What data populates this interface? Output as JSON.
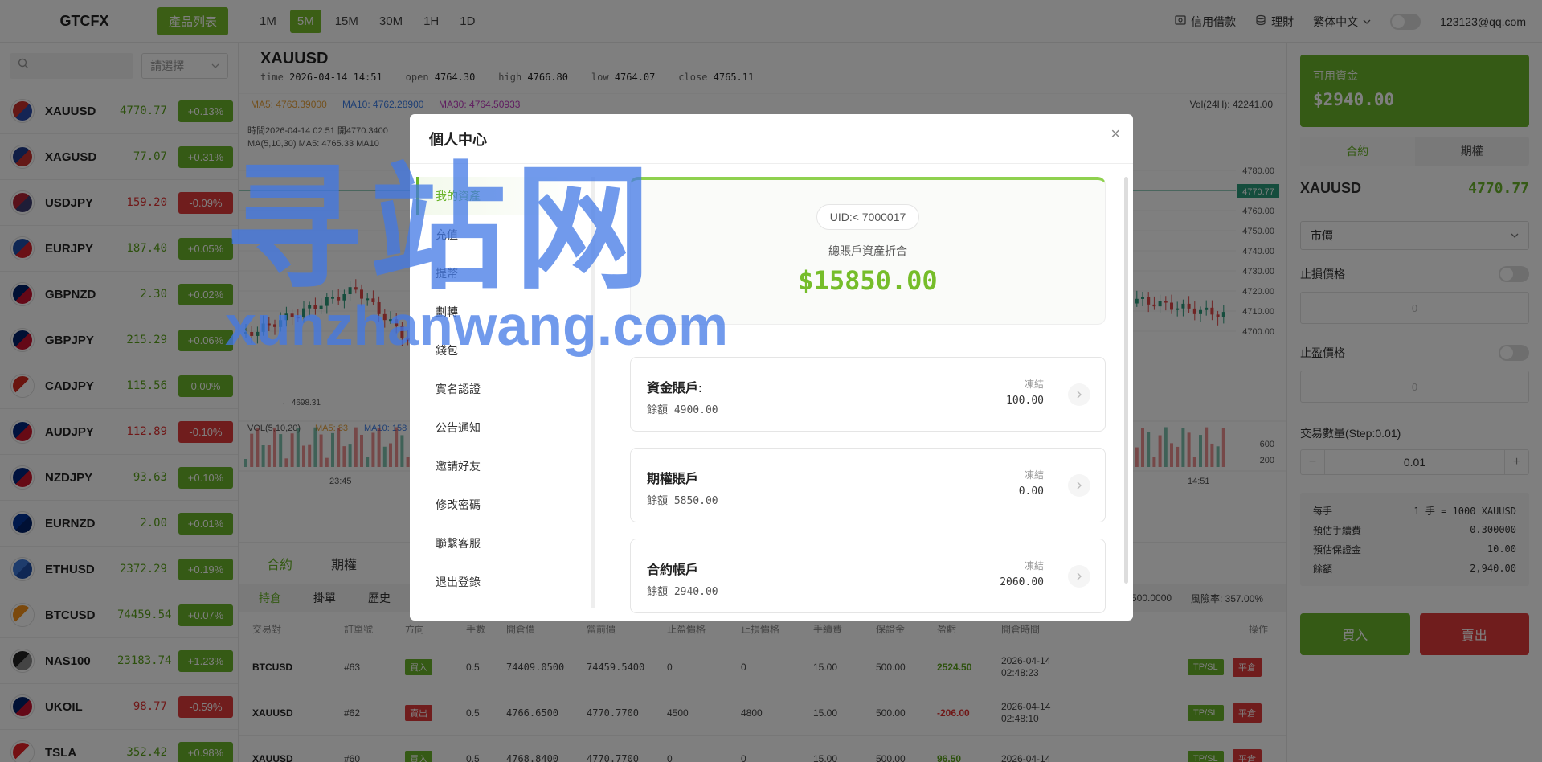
{
  "topbar": {
    "brand": "GTCFX",
    "product_list": "產品列表",
    "intervals": [
      "1M",
      "5M",
      "15M",
      "30M",
      "1H",
      "1D"
    ],
    "active_interval": "5M",
    "credit_loan": "信用借款",
    "finance": "理財",
    "language": "繁体中文",
    "user_email": "123123@qq.com"
  },
  "left": {
    "select_placeholder": "請選擇",
    "symbols": [
      {
        "name": "XAUUSD",
        "price": "4770.77",
        "change": "+0.13%",
        "dir": "up"
      },
      {
        "name": "XAGUSD",
        "price": "77.07",
        "change": "+0.31%",
        "dir": "up"
      },
      {
        "name": "USDJPY",
        "price": "159.20",
        "change": "-0.09%",
        "dir": "dn"
      },
      {
        "name": "EURJPY",
        "price": "187.40",
        "change": "+0.05%",
        "dir": "up"
      },
      {
        "name": "GBPNZD",
        "price": "2.30",
        "change": "+0.02%",
        "dir": "up"
      },
      {
        "name": "GBPJPY",
        "price": "215.29",
        "change": "+0.06%",
        "dir": "up"
      },
      {
        "name": "CADJPY",
        "price": "115.56",
        "change": "0.00%",
        "dir": "up"
      },
      {
        "name": "AUDJPY",
        "price": "112.89",
        "change": "-0.10%",
        "dir": "dn"
      },
      {
        "name": "NZDJPY",
        "price": "93.63",
        "change": "+0.10%",
        "dir": "up"
      },
      {
        "name": "EURNZD",
        "price": "2.00",
        "change": "+0.01%",
        "dir": "up"
      },
      {
        "name": "ETHUSD",
        "price": "2372.29",
        "change": "+0.19%",
        "dir": "up"
      },
      {
        "name": "BTCUSD",
        "price": "74459.54",
        "change": "+0.07%",
        "dir": "up"
      },
      {
        "name": "NAS100",
        "price": "23183.74",
        "change": "+1.23%",
        "dir": "up"
      },
      {
        "name": "UKOIL",
        "price": "98.77",
        "change": "-0.59%",
        "dir": "dn"
      },
      {
        "name": "TSLA",
        "price": "352.42",
        "change": "+0.98%",
        "dir": "up"
      }
    ]
  },
  "chart": {
    "symbol": "XAUUSD",
    "time_label": "time",
    "time": "2026-04-14 14:51",
    "open_label": "open",
    "open": "4764.30",
    "high_label": "high",
    "high": "4766.80",
    "low_label": "low",
    "low": "4764.07",
    "close_label": "close",
    "close": "4765.11",
    "ma5": "MA5: 4763.39000",
    "ma10": "MA10: 4762.28900",
    "ma30": "MA30: 4764.50933",
    "vol24h": "Vol(24H): 42241.00",
    "tooltip_line1": "時間2026-04-14 02:51  開4770.3400",
    "tooltip_line2": "MA(5,10,30)  MA5: 4765.33  MA10",
    "low_marker": "← 4698.31",
    "vol_label": "VOL(5,10,20)",
    "vol_ma5": "MA5: 83",
    "vol_ma10": "MA10: 158",
    "y_ticks": [
      "4780.00",
      "4770.00",
      "4760.00",
      "4750.00",
      "4740.00",
      "4730.00",
      "4720.00",
      "4710.00",
      "4700.00"
    ],
    "current_price_tag": "4770.77",
    "vol_ticks": [
      "600",
      "200"
    ],
    "x_ticks": [
      "23:45",
      "14:51"
    ],
    "colors": {
      "ma5": "#e8a23a",
      "ma10": "#3a7de8",
      "ma30": "#c03ac0",
      "up": "#2a9a7a",
      "down": "#e04848"
    }
  },
  "orders": {
    "tabs": [
      "合約",
      "期權"
    ],
    "subtabs": [
      "持倉",
      "掛單",
      "歷史"
    ],
    "summary_a": "500.0000",
    "summary_b": "風險率: 357.00%",
    "headers": [
      "交易對",
      "訂單號",
      "方向",
      "手數",
      "開倉價",
      "當前價",
      "止盈價格",
      "止損價格",
      "手續費",
      "保證金",
      "盈虧",
      "開倉時間",
      "操作"
    ],
    "rows": [
      {
        "pair": "BTCUSD",
        "id": "#63",
        "side": "買入",
        "side_dir": "up",
        "lots": "0.5",
        "open": "74409.0500",
        "cur": "74459.5400",
        "tp": "0",
        "sl": "0",
        "fee": "15.00",
        "margin": "500.00",
        "pnl": "2524.50",
        "pnl_dir": "up",
        "date": "2026-04-14",
        "time": "02:48:23"
      },
      {
        "pair": "XAUUSD",
        "id": "#62",
        "side": "賣出",
        "side_dir": "dn",
        "lots": "0.5",
        "open": "4766.6500",
        "cur": "4770.7700",
        "tp": "4500",
        "sl": "4800",
        "fee": "15.00",
        "margin": "500.00",
        "pnl": "-206.00",
        "pnl_dir": "dn",
        "date": "2026-04-14",
        "time": "02:48:10"
      },
      {
        "pair": "XAUUSD",
        "id": "#60",
        "side": "買入",
        "side_dir": "up",
        "lots": "0.5",
        "open": "4768.8400",
        "cur": "4770.7700",
        "tp": "0",
        "sl": "0",
        "fee": "15.00",
        "margin": "500.00",
        "pnl": "96.50",
        "pnl_dir": "up",
        "date": "2026-04-14",
        "time": ""
      }
    ],
    "tpsl_label": "TP/SL",
    "close_label": "平倉"
  },
  "right": {
    "available_label": "可用資金",
    "available_value": "$2940.00",
    "tabs": [
      "合約",
      "期權"
    ],
    "symbol": "XAUUSD",
    "price": "4770.77",
    "order_type": "市價",
    "stop_loss_label": "止損價格",
    "take_profit_label": "止盈價格",
    "input_placeholder": "0",
    "qty_label": "交易數量(Step:0.01)",
    "qty_minus": "−",
    "qty_value": "0.01",
    "qty_plus": "+",
    "info": [
      {
        "k": "每手",
        "v": "1 手 = 1000 XAUUSD"
      },
      {
        "k": "預估手續費",
        "v": "0.300000"
      },
      {
        "k": "預估保證金",
        "v": "10.00"
      },
      {
        "k": "餘額",
        "v": "2,940.00"
      }
    ],
    "buy": "買入",
    "sell": "賣出"
  },
  "modal": {
    "title": "個人中心",
    "close": "×",
    "nav": [
      "我的資產",
      "充值",
      "提幣",
      "劃轉",
      "錢包",
      "實名認證",
      "公告通知",
      "邀請好友",
      "修改密碼",
      "聯繫客服",
      "退出登錄"
    ],
    "uid": "UID:< 7000017",
    "total_label": "總賬戶資產折合",
    "total_value": "$15850.00",
    "accounts": [
      {
        "name": "資金賬戶:",
        "balance": "餘額 4900.00",
        "frozen_label": "凍結",
        "frozen": "100.00"
      },
      {
        "name": "期權賬戶",
        "balance": "餘額 5850.00",
        "frozen_label": "凍結",
        "frozen": "0.00"
      },
      {
        "name": "合約帳戶",
        "balance": "餘額 2940.00",
        "frozen_label": "凍結",
        "frozen": "2060.00"
      }
    ]
  },
  "watermark": {
    "line1": "寻站网",
    "line2": "xunzhanwang.com"
  }
}
